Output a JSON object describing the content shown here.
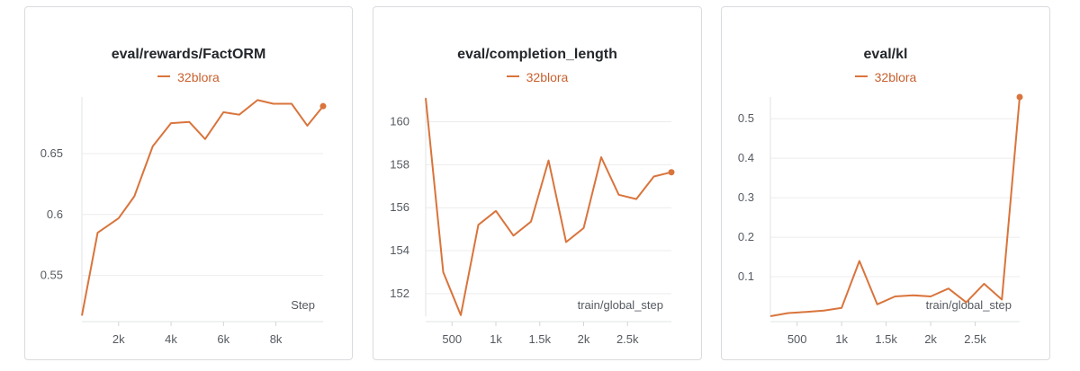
{
  "chart_data": [
    {
      "type": "line",
      "title": "eval/rewards/FactORM",
      "xlabel": "Step",
      "ylabel": "",
      "xlim": [
        600,
        9800
      ],
      "ylim": [
        0.5165,
        0.6965
      ],
      "xticks": [
        2000,
        4000,
        6000,
        8000
      ],
      "xtick_labels": [
        "2k",
        "4k",
        "6k",
        "8k"
      ],
      "yticks": [
        0.55,
        0.6,
        0.65
      ],
      "ytick_labels": [
        "0.55",
        "0.6",
        "0.65"
      ],
      "grid": true,
      "legend": "top-center",
      "series": [
        {
          "name": "32blora",
          "color": "#d9743c",
          "x": [
            600,
            1200,
            2000,
            2600,
            3300,
            4000,
            4700,
            5300,
            6000,
            6600,
            7300,
            7900,
            8600,
            9200,
            9800
          ],
          "y": [
            0.517,
            0.585,
            0.597,
            0.615,
            0.656,
            0.675,
            0.676,
            0.662,
            0.684,
            0.682,
            0.694,
            0.691,
            0.691,
            0.673,
            0.689
          ]
        }
      ]
    },
    {
      "type": "line",
      "title": "eval/completion_length",
      "xlabel": "train/global_step",
      "ylabel": "",
      "xlim": [
        200,
        3000
      ],
      "ylim": [
        150.95,
        161.15
      ],
      "xticks": [
        500,
        1000,
        1500,
        2000,
        2500
      ],
      "xtick_labels": [
        "500",
        "1k",
        "1.5k",
        "2k",
        "2.5k"
      ],
      "yticks": [
        152,
        154,
        156,
        158,
        160
      ],
      "ytick_labels": [
        "152",
        "154",
        "156",
        "158",
        "160"
      ],
      "grid": true,
      "legend": "top-center",
      "series": [
        {
          "name": "32blora",
          "color": "#d9743c",
          "x": [
            200,
            400,
            600,
            800,
            1000,
            1200,
            1400,
            1600,
            1800,
            2000,
            2200,
            2400,
            2600,
            2800,
            3000
          ],
          "y": [
            161.1,
            153.0,
            151.0,
            155.2,
            155.85,
            154.7,
            155.35,
            158.2,
            154.4,
            155.05,
            158.35,
            156.6,
            156.4,
            157.45,
            157.65
          ]
        }
      ]
    },
    {
      "type": "line",
      "title": "eval/kl",
      "xlabel": "train/global_step",
      "ylabel": "",
      "xlim": [
        200,
        3000
      ],
      "ylim": [
        0,
        0.555
      ],
      "xticks": [
        500,
        1000,
        1500,
        2000,
        2500
      ],
      "xtick_labels": [
        "500",
        "1k",
        "1.5k",
        "2k",
        "2.5k"
      ],
      "yticks": [
        0.1,
        0.2,
        0.3,
        0.4,
        0.5
      ],
      "ytick_labels": [
        "0.1",
        "0.2",
        "0.3",
        "0.4",
        "0.5"
      ],
      "grid": true,
      "legend": "top-center",
      "series": [
        {
          "name": "32blora",
          "color": "#d9743c",
          "x": [
            200,
            400,
            600,
            800,
            1000,
            1200,
            1400,
            1600,
            1800,
            2000,
            2200,
            2400,
            2600,
            2800,
            3000
          ],
          "y": [
            0.0,
            0.008,
            0.011,
            0.014,
            0.021,
            0.14,
            0.03,
            0.05,
            0.053,
            0.05,
            0.07,
            0.035,
            0.082,
            0.042,
            0.555
          ]
        }
      ]
    }
  ]
}
